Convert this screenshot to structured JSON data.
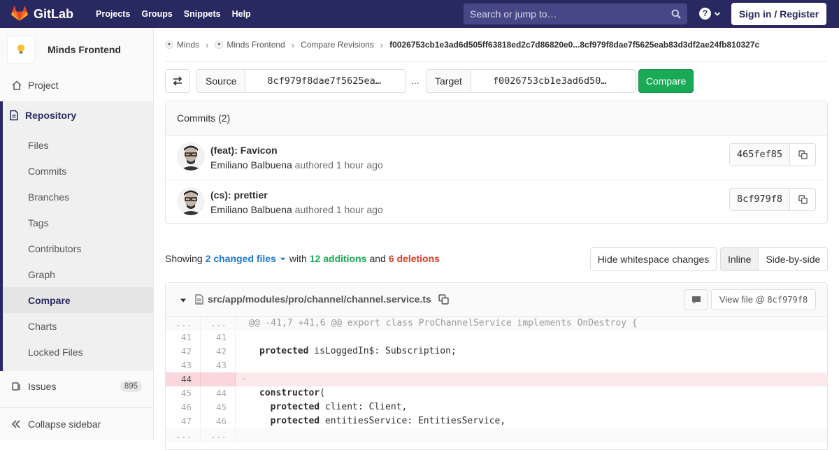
{
  "navbar": {
    "brand": "GitLab",
    "links": [
      "Projects",
      "Groups",
      "Snippets",
      "Help"
    ],
    "search_placeholder": "Search or jump to…",
    "help_label": "?",
    "signin": "Sign in / Register"
  },
  "sidebar": {
    "project_name": "Minds Frontend",
    "project_icon": "lightbulb",
    "project_label": "Project",
    "repository_label": "Repository",
    "repo_items": [
      "Files",
      "Commits",
      "Branches",
      "Tags",
      "Contributors",
      "Graph",
      "Compare",
      "Charts",
      "Locked Files"
    ],
    "active_item": "Compare",
    "issues_label": "Issues",
    "issues_count": "895",
    "collapse_label": "Collapse sidebar"
  },
  "breadcrumb": {
    "items": [
      "Minds",
      "Minds Frontend",
      "Compare Revisions"
    ],
    "current": "f0026753cb1e3ad6d505ff63818ed2c7d86820e0...8cf979f8dae7f5625eab83d3df2ae24fb810327c"
  },
  "compare": {
    "source_label": "Source",
    "source_value": "8cf979f8dae7f5625ea…",
    "dots": "...",
    "target_label": "Target",
    "target_value": "f0026753cb1e3ad6d50…",
    "compare_button": "Compare"
  },
  "commits": {
    "header": "Commits (2)",
    "items": [
      {
        "title": "(feat): Favicon",
        "author": "Emiliano Balbuena",
        "authored": "authored",
        "time": "1 hour ago",
        "sha": "465fef85"
      },
      {
        "title": "(cs): prettier",
        "author": "Emiliano Balbuena",
        "authored": "authored",
        "time": "1 hour ago",
        "sha": "8cf979f8"
      }
    ]
  },
  "summary": {
    "showing": "Showing",
    "changed_files": "2 changed files",
    "with": "with",
    "additions": "12 additions",
    "and": "and",
    "deletions": "6 deletions",
    "whitespace_button": "Hide whitespace changes",
    "inline_button": "Inline",
    "side_by_side_button": "Side-by-side"
  },
  "file": {
    "path": "src/app/modules/pro/channel/channel.service.ts",
    "view_file_label": "View file @",
    "view_file_sha": "8cf979f8",
    "lines": [
      {
        "type": "match",
        "old": "...",
        "new": "...",
        "code": "@@ -41,7 +41,6 @@ export class ProChannelService implements OnDestroy {"
      },
      {
        "type": "context",
        "old": "41",
        "new": "41",
        "code": ""
      },
      {
        "type": "context",
        "old": "42",
        "new": "42",
        "kw": "protected",
        "code": " isLoggedIn$: Subscription;"
      },
      {
        "type": "context",
        "old": "43",
        "new": "43",
        "code": ""
      },
      {
        "type": "removed",
        "old": "44",
        "new": "",
        "code": "-"
      },
      {
        "type": "context",
        "old": "45",
        "new": "44",
        "kw": "constructor",
        "code": "("
      },
      {
        "type": "context",
        "old": "46",
        "new": "45",
        "kw": "  protected",
        "code": " client: Client,"
      },
      {
        "type": "context",
        "old": "47",
        "new": "46",
        "kw": "  protected",
        "code": " entitiesService: EntitiesService,"
      },
      {
        "type": "match",
        "old": "...",
        "new": "...",
        "code": ""
      }
    ]
  },
  "colors": {
    "navbar": "#292961",
    "accent": "#1f78d1",
    "addition": "#1aaa55",
    "deletion": "#db3b21",
    "compare_button": "#1aaa55"
  }
}
